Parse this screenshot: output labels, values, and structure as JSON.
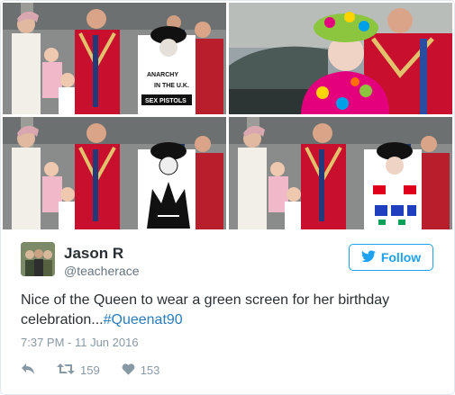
{
  "photos": {
    "top_left": {
      "sign_lines": [
        "ANARCHY",
        "IN THE U.K.",
        "SEX PISTOLS"
      ]
    },
    "top_right": {},
    "bottom_left": {},
    "bottom_right": {}
  },
  "tweet": {
    "display_name": "Jason R",
    "screen_name": "@teacherace",
    "follow_label": "Follow",
    "text": "Nice of the Queen to wear a green screen for her birthday celebration...",
    "hashtag": "#Queenat90",
    "timestamp": "7:37 PM - 11 Jun 2016",
    "retweet_count": "159",
    "like_count": "153"
  },
  "colors": {
    "twitter_blue": "#1da1f2",
    "hashtag_blue": "#2b7bb9",
    "muted_gray": "#8899a6",
    "uniform_red": "#c8102e"
  },
  "icons": [
    "twitter-bird-icon",
    "reply-icon",
    "retweet-icon",
    "heart-icon"
  ]
}
